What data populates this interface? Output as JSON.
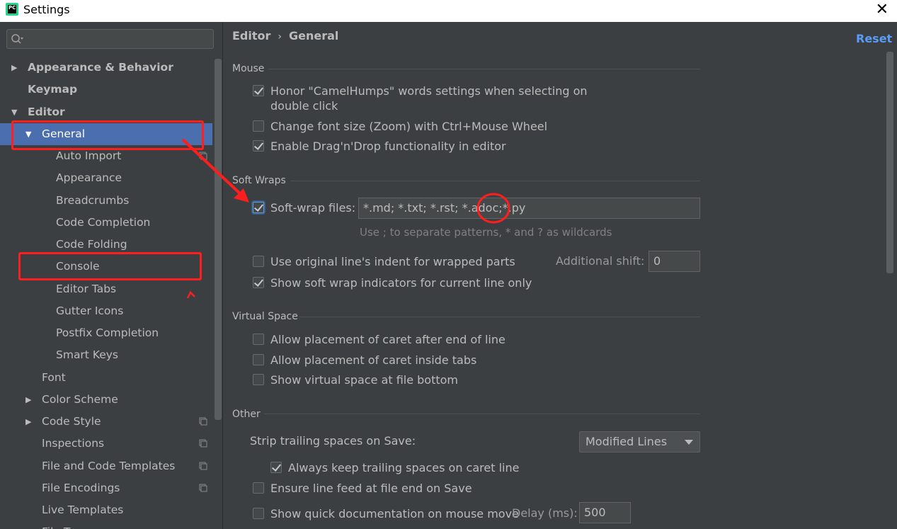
{
  "window": {
    "title": "Settings"
  },
  "sidebar": {
    "search_placeholder": "",
    "items": [
      {
        "label": "Appearance & Behavior"
      },
      {
        "label": "Keymap"
      },
      {
        "label": "Editor"
      },
      {
        "label": "General"
      },
      {
        "label": "Auto Import"
      },
      {
        "label": "Appearance"
      },
      {
        "label": "Breadcrumbs"
      },
      {
        "label": "Code Completion"
      },
      {
        "label": "Code Folding"
      },
      {
        "label": "Console"
      },
      {
        "label": "Editor Tabs"
      },
      {
        "label": "Gutter Icons"
      },
      {
        "label": "Postfix Completion"
      },
      {
        "label": "Smart Keys"
      },
      {
        "label": "Font"
      },
      {
        "label": "Color Scheme"
      },
      {
        "label": "Code Style"
      },
      {
        "label": "Inspections"
      },
      {
        "label": "File and Code Templates"
      },
      {
        "label": "File Encodings"
      },
      {
        "label": "Live Templates"
      },
      {
        "label": "File Types"
      }
    ]
  },
  "main": {
    "breadcrumb": [
      "Editor",
      "General"
    ],
    "breadcrumb_sep": "›",
    "reset_label": "Reset",
    "sections": {
      "mouse": {
        "title": "Mouse",
        "options": [
          {
            "label": "Honor \"CamelHumps\" words settings when selecting on",
            "label2": "double click",
            "checked": true
          },
          {
            "label": "Change font size (Zoom) with Ctrl+Mouse Wheel",
            "checked": false
          },
          {
            "label": "Enable Drag'n'Drop functionality in editor",
            "checked": true
          }
        ]
      },
      "soft_wraps": {
        "title": "Soft Wraps",
        "soft_wrap_label": "Soft-wrap files:",
        "soft_wrap_checked": true,
        "soft_wrap_value": "*.md; *.txt; *.rst; *.adoc;*.py",
        "hint": "Use ; to separate patterns, * and ? as wildcards",
        "indent_label": "Use original line's indent for wrapped parts",
        "indent_checked": false,
        "additional_shift_label": "Additional shift:",
        "additional_shift_value": "0",
        "indicators_label": "Show soft wrap indicators for current line only",
        "indicators_checked": true
      },
      "virtual_space": {
        "title": "Virtual Space",
        "options": [
          {
            "label": "Allow placement of caret after end of line",
            "checked": false
          },
          {
            "label": "Allow placement of caret inside tabs",
            "checked": false
          },
          {
            "label": "Show virtual space at file bottom",
            "checked": false
          }
        ]
      },
      "other": {
        "title": "Other",
        "strip_label": "Strip trailing spaces on Save:",
        "strip_value": "Modified Lines",
        "keep_trailing_label": "Always keep trailing spaces on caret line",
        "keep_trailing_checked": true,
        "line_feed_label": "Ensure line feed at file end on Save",
        "line_feed_checked": false,
        "quick_doc_label": "Show quick documentation on mouse move",
        "quick_doc_checked": false,
        "delay_label": "Delay (ms):",
        "delay_value": "500"
      }
    }
  },
  "colors": {
    "background": "#3c3f41",
    "selection": "#4b6eaf",
    "link": "#589df6",
    "annotation": "#ff1e1e"
  },
  "icons": [
    "pycharm-app-icon",
    "close-icon",
    "search-icon",
    "expand-arrow-icon",
    "collapse-arrow-icon",
    "project-scope-icon",
    "checkbox-checked-icon",
    "dropdown-arrow-icon"
  ]
}
